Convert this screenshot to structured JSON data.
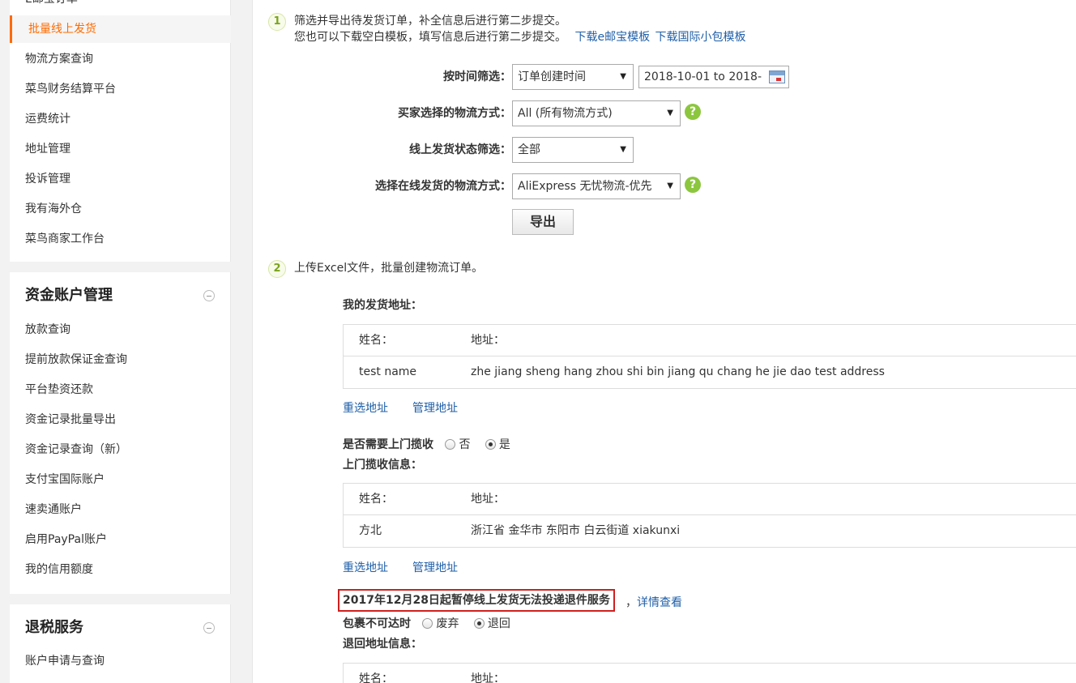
{
  "sidebar": {
    "cut_item": "E邮宝订单",
    "logistics_items": [
      {
        "label": "批量线上发货",
        "active": true
      },
      {
        "label": "物流方案查询"
      },
      {
        "label": "菜鸟财务结算平台"
      },
      {
        "label": "运费统计"
      },
      {
        "label": "地址管理"
      },
      {
        "label": "投诉管理"
      },
      {
        "label": "我有海外仓"
      },
      {
        "label": "菜鸟商家工作台"
      }
    ],
    "funds_title": "资金账户管理",
    "funds_items": [
      {
        "label": "放款查询"
      },
      {
        "label": "提前放款保证金查询"
      },
      {
        "label": "平台垫资还款"
      },
      {
        "label": "资金记录批量导出"
      },
      {
        "label": "资金记录查询（新）"
      },
      {
        "label": "支付宝国际账户"
      },
      {
        "label": "速卖通账户"
      },
      {
        "label": "启用PayPal账户"
      },
      {
        "label": "我的信用额度"
      }
    ],
    "tax_title": "退税服务",
    "tax_items": [
      {
        "label": "账户申请与查询"
      }
    ]
  },
  "step1": {
    "num": "1",
    "line1": "筛选并导出待发货订单，补全信息后进行第二步提交。",
    "line2": "您也可以下载空白模板，填写信息后进行第二步提交。",
    "link_eub": "下载e邮宝模板",
    "link_intl": "下载国际小包模板",
    "time_filter_label": "按时间筛选：",
    "time_filter_value": "订单创建时间",
    "date_range": "2018-10-01 to 2018-",
    "buyer_shipping_label": "买家选择的物流方式：",
    "buyer_shipping_value": "All (所有物流方式)",
    "status_label": "线上发货状态筛选：",
    "status_value": "全部",
    "online_shipping_label": "选择在线发货的物流方式：",
    "online_shipping_value": "AliExpress 无忧物流-优先",
    "help_glyph": "?",
    "export_button": "导出"
  },
  "step2": {
    "num": "2",
    "title": "上传Excel文件，批量创建物流订单。",
    "sender_title": "我的发货地址：",
    "col_name": "姓名：",
    "col_address": "地址：",
    "sender_name": "test name",
    "sender_address": "zhe jiang sheng hang zhou shi bin jiang qu chang he jie dao test address",
    "reselect": "重选地址",
    "manage": "管理地址",
    "pickup_question": "是否需要上门揽收",
    "opt_no": "否",
    "opt_yes": "是",
    "pickup_title": "上门揽收信息：",
    "pickup_name": "方北",
    "pickup_address": "浙江省 金华市 东阳市 白云街道 xiakunxi",
    "notice": "2017年12月28日起暂停线上发货无法投递退件服务",
    "notice_comma": "，",
    "notice_link": "详情查看",
    "undeliverable_label": "包裹不可达时",
    "opt_discard": "废弃",
    "opt_return": "退回",
    "return_title": "退回地址信息："
  },
  "colors": {
    "accent": "#ff6a00",
    "link": "#1f5fa8",
    "help": "#8cc63f",
    "notice_border": "#d01f1f"
  }
}
